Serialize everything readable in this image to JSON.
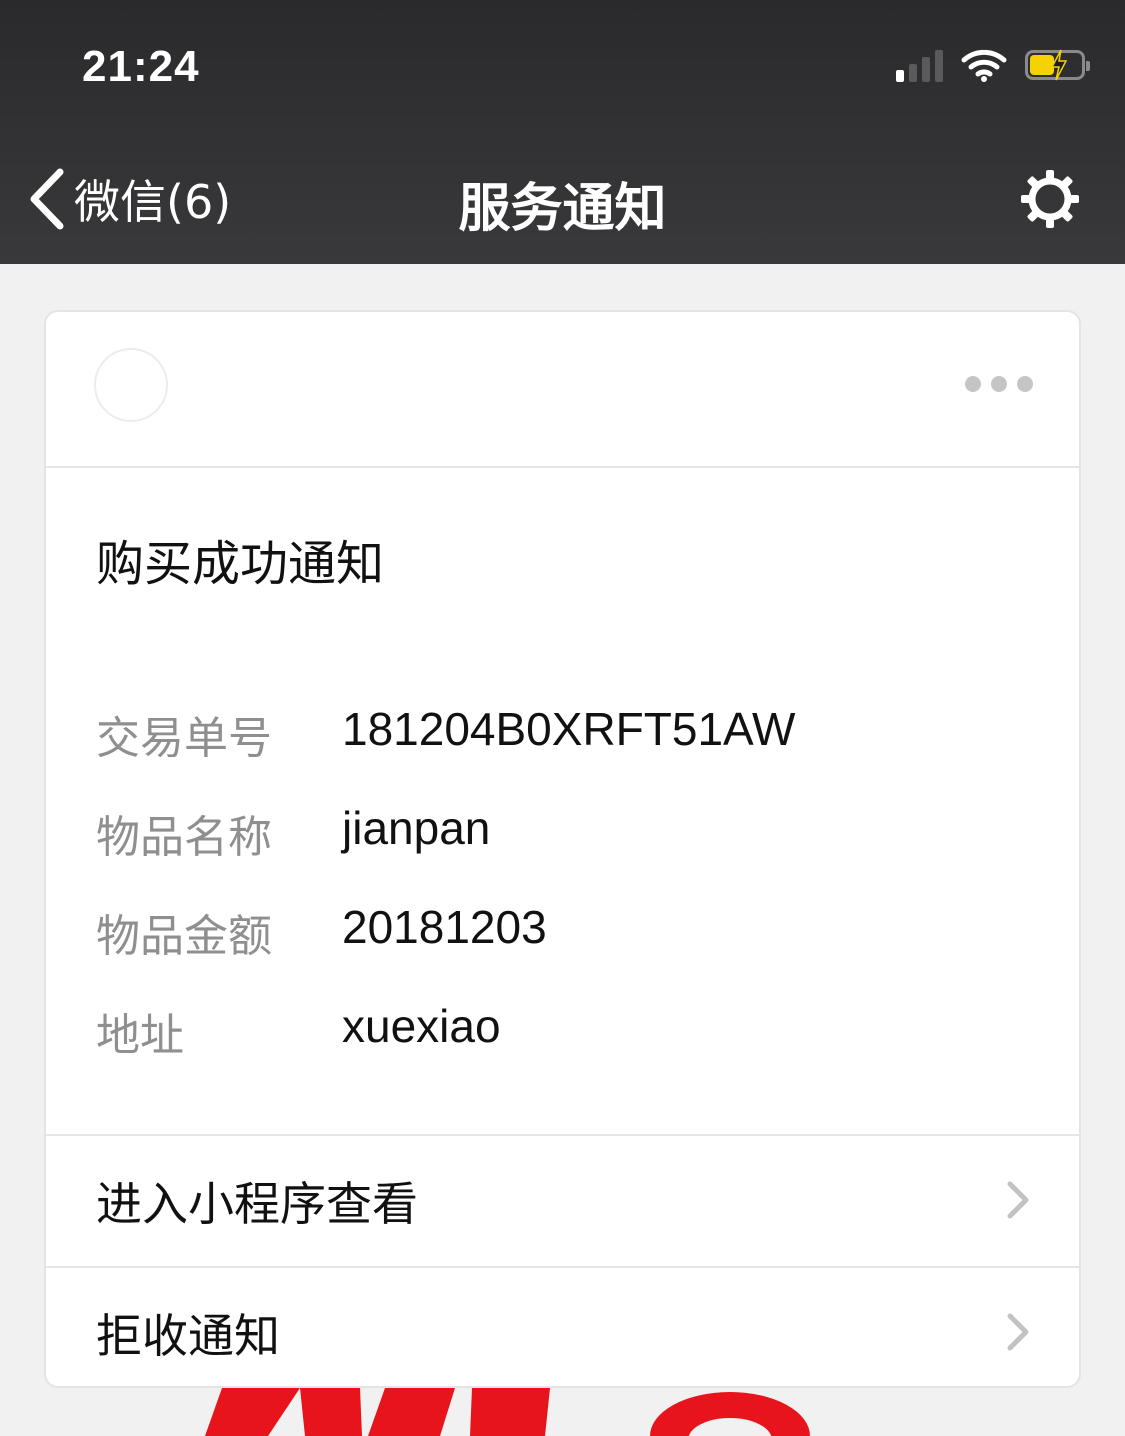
{
  "status_bar": {
    "time": "21:24",
    "signal_bars_active": 1,
    "battery_level": 0.45,
    "battery_color": "#f5d300"
  },
  "nav": {
    "back_label": "微信(6)",
    "title": "服务通知",
    "settings_icon": "gear-icon"
  },
  "card": {
    "more_icon": "more-dots-icon",
    "title": "购买成功通知",
    "fields": [
      {
        "label": "交易单号",
        "value": "181204B0XRFT51AW"
      },
      {
        "label": "物品名称",
        "value": "jianpan"
      },
      {
        "label": "物品金额",
        "value": "20181203"
      },
      {
        "label": "地址",
        "value": "xuexiao"
      }
    ],
    "actions": [
      {
        "label": "进入小程序查看"
      },
      {
        "label": "拒收通知"
      }
    ]
  },
  "colors": {
    "header_bg": "#39393b",
    "page_bg": "#f1f1f1",
    "label_gray": "#8f8f8f",
    "background_art_red": "#e8141b"
  }
}
